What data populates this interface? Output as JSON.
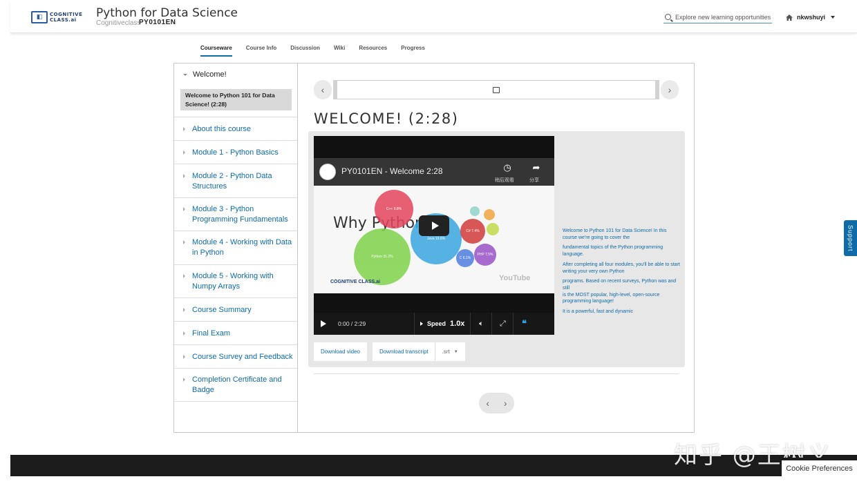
{
  "header": {
    "logo_text_1": "COGNITIVE",
    "logo_text_2": "CLASS.ai",
    "course_title": "Python for Data Science",
    "org": "Cognitiveclass",
    "course_number": "PY0101EN",
    "search_placeholder": "Explore new learning opportunities",
    "username": "nkwshuyi"
  },
  "tabs": [
    {
      "label": "Courseware",
      "active": true
    },
    {
      "label": "Course Info",
      "active": false
    },
    {
      "label": "Discussion",
      "active": false
    },
    {
      "label": "Wiki",
      "active": false
    },
    {
      "label": "Resources",
      "active": false
    },
    {
      "label": "Progress",
      "active": false
    }
  ],
  "sidebar": {
    "chapter": "Welcome!",
    "active_subsection": "Welcome to Python 101 for Data Science! (2:28)",
    "sections": [
      "About this course",
      "Module 1 - Python Basics",
      "Module 2 - Python Data Structures",
      "Module 3 - Python Programming Fundamentals",
      "Module 4 - Working with Data in Python",
      "Module 5 - Working with Numpy Arrays",
      "Course Summary",
      "Final Exam",
      "Course Survey and Feedback",
      "Completion Certificate and Badge"
    ]
  },
  "unit": {
    "title": "WELCOME! (2:28)"
  },
  "video": {
    "yt_title": "PY0101EN - Welcome 2:28",
    "watch_later": "稍后观看",
    "share": "分享",
    "slide_heading": "Why Python?",
    "slide_logo": "COGNITIVE CLASS.ai",
    "yt_logo": "YouTube",
    "time": "0:00 / 2:29",
    "speed_label": "Speed",
    "speed_value": "1.0x",
    "bubbles": [
      {
        "label": "C++ 9.8%",
        "color": "#e4455d"
      },
      {
        "label": "Python 31.2%",
        "color": "#7fd24a"
      },
      {
        "label": "Java 19.6%",
        "color": "#3ba7e0"
      },
      {
        "label": "C# 7.4%",
        "color": "#d23a3a"
      },
      {
        "label": "PHP 7.5%",
        "color": "#9a53c8"
      },
      {
        "label": "C 6.1%",
        "color": "#4e7fe0"
      },
      {
        "label": "",
        "color": "#c2d94a"
      },
      {
        "label": "",
        "color": "#f0a640"
      },
      {
        "label": "",
        "color": "#8fd3c8"
      }
    ]
  },
  "transcript": [
    "Welcome to Python 101 for Data Science! In this course we're going to cover the",
    "fundamental topics of the Python programming language.",
    "After completing all four modules, you'll be able to start writing your very own Python",
    "programs. Based on recent surveys, Python was and still",
    "is the MOST popular, high-level, open-source programming language!",
    "It is a powerful, fast and dynamic"
  ],
  "downloads": {
    "video": "Download video",
    "transcript": "Download transcript",
    "format": ".srt"
  },
  "support_label": "Support",
  "watermark": "知乎 @王树义",
  "cookie_label": "Cookie Preferences"
}
